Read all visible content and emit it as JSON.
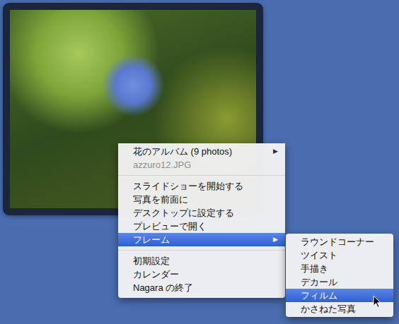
{
  "menu": {
    "items": [
      {
        "kind": "item",
        "label": "花のアルバム (9 photos)",
        "disabled": false,
        "selected": false,
        "arrow": "▶"
      },
      {
        "kind": "item",
        "label": "azzuro12.JPG",
        "disabled": true,
        "selected": false,
        "arrow": ""
      },
      {
        "kind": "separator",
        "label": "",
        "disabled": false,
        "selected": false,
        "arrow": ""
      },
      {
        "kind": "item",
        "label": "スライドショーを開始する",
        "disabled": false,
        "selected": false,
        "arrow": ""
      },
      {
        "kind": "item",
        "label": "写真を前面に",
        "disabled": false,
        "selected": false,
        "arrow": ""
      },
      {
        "kind": "item",
        "label": "デスクトップに設定する",
        "disabled": false,
        "selected": false,
        "arrow": ""
      },
      {
        "kind": "item",
        "label": "プレビューで開く",
        "disabled": false,
        "selected": false,
        "arrow": ""
      },
      {
        "kind": "item",
        "label": "フレーム",
        "disabled": false,
        "selected": true,
        "arrow": "▶"
      },
      {
        "kind": "separator",
        "label": "",
        "disabled": false,
        "selected": false,
        "arrow": ""
      },
      {
        "kind": "item",
        "label": "初期設定",
        "disabled": false,
        "selected": false,
        "arrow": ""
      },
      {
        "kind": "item",
        "label": "カレンダー",
        "disabled": false,
        "selected": false,
        "arrow": ""
      },
      {
        "kind": "item",
        "label": "Nagara の終了",
        "disabled": false,
        "selected": false,
        "arrow": ""
      }
    ]
  },
  "submenu": {
    "items": [
      {
        "label": "ラウンドコーナー",
        "selected": false
      },
      {
        "label": "ツイスト",
        "selected": false
      },
      {
        "label": "手描き",
        "selected": false
      },
      {
        "label": "デカール",
        "selected": false
      },
      {
        "label": "フィルム",
        "selected": true
      },
      {
        "label": "かさねた写真",
        "selected": false
      }
    ]
  }
}
